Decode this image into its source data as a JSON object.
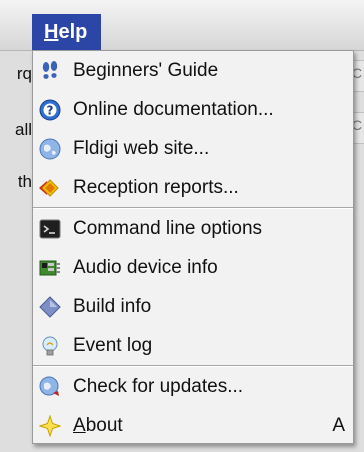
{
  "menubar": {
    "help_prefix": "H",
    "help_rest": "elp"
  },
  "background": {
    "fragments": [
      "rq",
      "all",
      "th"
    ],
    "right_glyph": "C"
  },
  "menu": {
    "items": [
      {
        "label": "Beginners' Guide",
        "icon": "footprints-icon"
      },
      {
        "label": "Online documentation...",
        "icon": "help-circle-icon"
      },
      {
        "label": "Fldigi web site...",
        "icon": "globe-icon"
      },
      {
        "label": "Reception reports...",
        "icon": "reception-report-icon"
      },
      {
        "label": "Command line options",
        "icon": "terminal-icon"
      },
      {
        "label": "Audio device info",
        "icon": "audio-card-icon"
      },
      {
        "label": "Build info",
        "icon": "diamond-icon"
      },
      {
        "label": "Event log",
        "icon": "lightbulb-icon"
      },
      {
        "label": "Check for updates...",
        "icon": "update-globe-icon"
      },
      {
        "label_prefix": "A",
        "label_rest": "bout",
        "icon": "star-icon",
        "shortcut": "A"
      }
    ]
  },
  "colors": {
    "menubar_highlight": "#2c46a8",
    "menu_background": "#f2f2f2"
  }
}
